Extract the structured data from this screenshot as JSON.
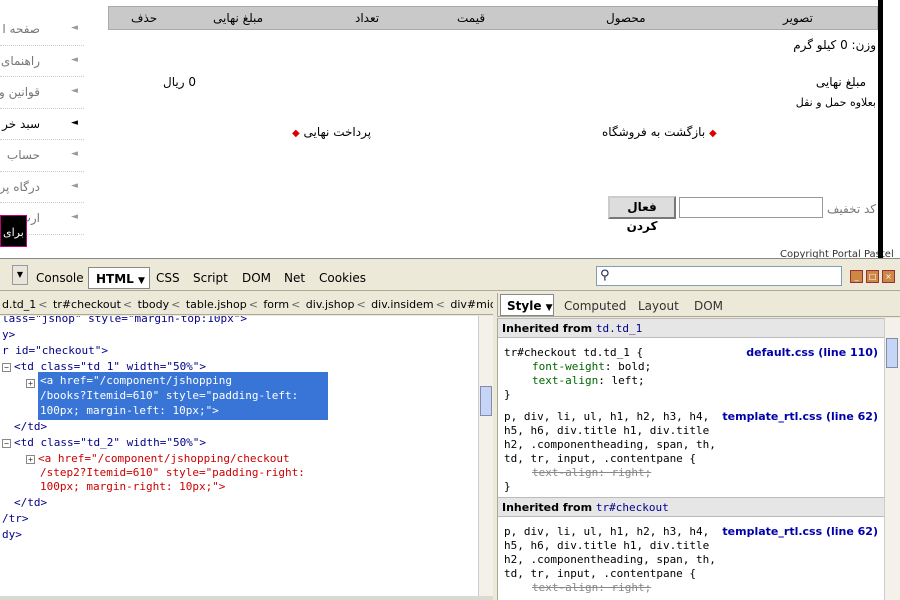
{
  "webpage": {
    "side_menu": [
      {
        "label": "صفحه ا",
        "active": false
      },
      {
        "label": "راهنمای",
        "active": false
      },
      {
        "label": "قوانین و",
        "active": false
      },
      {
        "label": "سبد خر",
        "active": true
      },
      {
        "label": "حساب",
        "active": false
      },
      {
        "label": "درگاه پر",
        "active": false
      },
      {
        "label": "ارت",
        "active": false
      }
    ],
    "side_badge": "برای",
    "cart_columns": {
      "image": "تصویر",
      "product": "محصول",
      "price": "قیمت",
      "quantity": "تعداد",
      "final_amount": "مبلغ نهایی",
      "delete": "حذف"
    },
    "weight": "وزن: 0 کیلو گرم",
    "total_label": "مبلغ نهایی",
    "total_value": "0 ریال",
    "shipping_note": "بعلاوه حمل و نقل",
    "back_link": "بازگشت به فروشگاه",
    "final_link": "پرداخت نهایی",
    "coupon_label": "کد تخفیف",
    "activate_button": "فعال کردن",
    "copyright": "Copyright Portal Pastel"
  },
  "firebug": {
    "tabs": {
      "console": "Console",
      "html": "HTML",
      "css": "CSS",
      "script": "Script",
      "dom": "DOM",
      "net": "Net",
      "cookies": "Cookies"
    },
    "breadcrumb": [
      "d.td_1",
      "tr#checkout",
      "tbody",
      "table.jshop",
      "form",
      "div.jshop",
      "div.insidem",
      "div#midblock",
      "d"
    ],
    "side_tabs": {
      "style": "Style",
      "computed": "Computed",
      "layout": "Layout",
      "dom": "DOM"
    },
    "html_lines": [
      "lass=\"jshop\" style=\"margin-top:10px\">",
      "y>",
      "r id=\"checkout\">",
      "<td class=\"td_1\" width=\"50%\">",
      "<a href=\"/component/jshopping",
      "/books?Itemid=610\" style=\"padding-left:",
      "100px; margin-left: 10px;\">",
      "</td>",
      "<td class=\"td_2\" width=\"50%\">",
      "<a href=\"/component/jshopping/checkout",
      "/step2?Itemid=610\" style=\"padding-right:",
      "100px; margin-right: 10px;\">",
      "</td>",
      "/tr>",
      "dy>"
    ],
    "style": {
      "inherited_1_label": "Inherited from",
      "inherited_1_ref": "td.td_1",
      "rule1_selector": "tr#checkout td.td_1 {",
      "rule1_src": "default.css (line 110)",
      "rule1_p1_name": "font-weight",
      "rule1_p1_val": ": bold;",
      "rule1_p2_name": "text-align",
      "rule1_p2_val": ": left;",
      "close": "}",
      "rule2_sel1": "p, div, li, ul, h1, h2, h3, h4,",
      "rule2_sel2": "h5, h6, div.title h1, div.title",
      "rule2_sel3": "h2, .componentheading, span, th,",
      "rule2_sel4": "td, tr, input, .contentpane {",
      "rule2_src": "template_rtl.css (line 62)",
      "rule2_p1_name": "text-align",
      "rule2_p1_val": ": right;",
      "inherited_2_label": "Inherited from",
      "inherited_2_ref": "tr#checkout",
      "rule3_src": "template_rtl.css (line 62)"
    }
  }
}
